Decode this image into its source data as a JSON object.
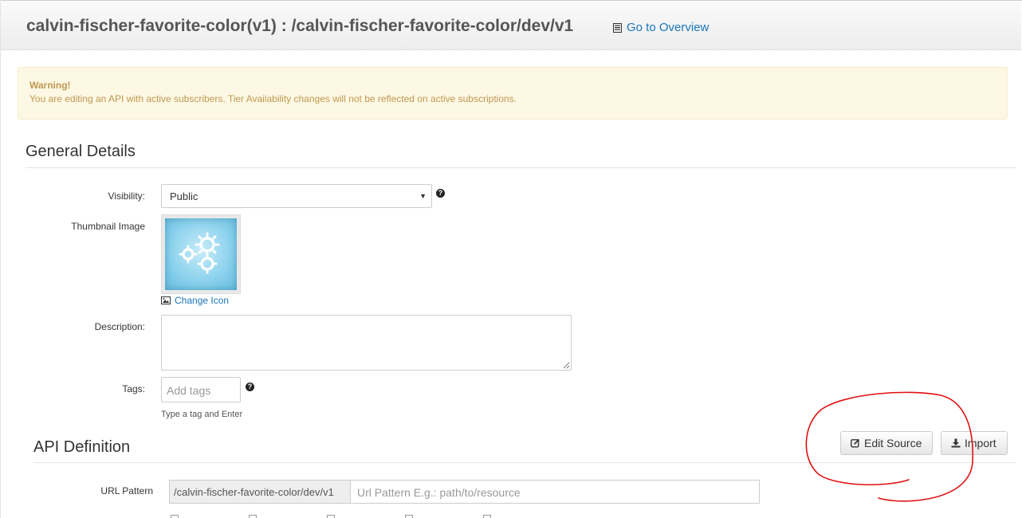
{
  "header": {
    "title": "calvin-fischer-favorite-color(v1) : /calvin-fischer-favorite-color/dev/v1",
    "overview_link": "Go to Overview"
  },
  "alert": {
    "title": "Warning!",
    "text": "You are editing an API with active subscribers. Tier Availability changes will not be reflected on active subscriptions."
  },
  "general_details": {
    "heading": "General Details",
    "visibility_label": "Visibility:",
    "visibility_value": "Public",
    "thumbnail_label": "Thumbnail Image",
    "change_icon": "Change Icon",
    "description_label": "Description:",
    "description_value": "",
    "tags_label": "Tags:",
    "tags_placeholder": "Add tags",
    "tags_help": "Type a tag and Enter"
  },
  "api_definition": {
    "heading": "API Definition",
    "edit_source": "Edit Source",
    "import": "Import",
    "url_pattern_label": "URL Pattern",
    "url_prefix": "/calvin-fischer-favorite-color/dev/v1",
    "url_placeholder": "Url Pattern E.g.: path/to/resource"
  },
  "colors": {
    "link": "#1b75bb",
    "warning_bg": "#fcf8e3",
    "warning_text": "#c09853",
    "annotation": "#e01010"
  }
}
